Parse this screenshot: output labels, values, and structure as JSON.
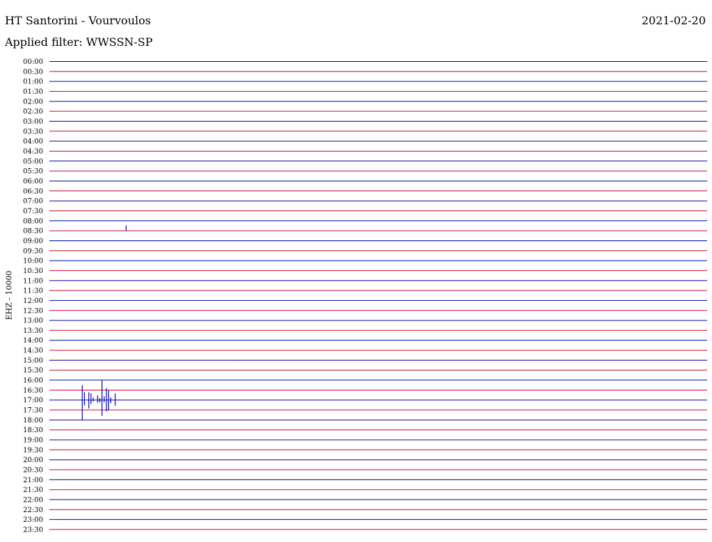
{
  "header": {
    "title": "HT Santorini - Vourvoulos",
    "date": "2021-02-20",
    "filter_label": "Applied filter: WWSSN-SP"
  },
  "chart_data": {
    "type": "line",
    "title": "HT Santorini - Vourvoulos",
    "ylabel": "EHZ - 10000",
    "row_labels": [
      "00:00",
      "00:30",
      "01:00",
      "01:30",
      "02:00",
      "02:30",
      "03:00",
      "03:30",
      "04:00",
      "04:30",
      "05:00",
      "05:30",
      "06:00",
      "06:30",
      "07:00",
      "07:30",
      "08:00",
      "08:30",
      "09:00",
      "09:30",
      "10:00",
      "10:30",
      "11:00",
      "11:30",
      "12:00",
      "12:30",
      "13:00",
      "13:30",
      "14:00",
      "14:30",
      "15:00",
      "15:30",
      "16:00",
      "16:30",
      "17:00",
      "17:30",
      "18:00",
      "18:30",
      "19:00",
      "19:30",
      "20:00",
      "20:30",
      "21:00",
      "21:30",
      "22:00",
      "22:30",
      "23:00",
      "23:30"
    ],
    "row_duration_minutes": 30,
    "row_colors": [
      "#0000aa",
      "#cc0033"
    ],
    "trace_color": "#0000aa",
    "grid": false,
    "events": [
      {
        "row": "08:30",
        "minute": 3.5,
        "min": -0.1,
        "max": 2.0
      },
      {
        "row": "15:00",
        "minute": 8.5,
        "min": -0.1,
        "max": 0.1
      },
      {
        "row": "17:00",
        "minute": 1.5,
        "min": -7.5,
        "max": 5.6
      },
      {
        "row": "17:00",
        "minute": 1.6,
        "min": -2.0,
        "max": 3.0
      },
      {
        "row": "17:00",
        "minute": 1.8,
        "min": -3.2,
        "max": 2.9
      },
      {
        "row": "17:00",
        "minute": 1.9,
        "min": -1.5,
        "max": 2.6
      },
      {
        "row": "17:00",
        "minute": 2.0,
        "min": -0.5,
        "max": 1.0
      },
      {
        "row": "17:00",
        "minute": 2.2,
        "min": -1.0,
        "max": 1.8
      },
      {
        "row": "17:00",
        "minute": 2.3,
        "min": -0.9,
        "max": 0.8
      },
      {
        "row": "17:00",
        "minute": 2.4,
        "min": -6.0,
        "max": 7.7
      },
      {
        "row": "17:00",
        "minute": 2.5,
        "min": -0.8,
        "max": 1.4
      },
      {
        "row": "17:00",
        "minute": 2.6,
        "min": -4.3,
        "max": 4.5
      },
      {
        "row": "17:00",
        "minute": 2.7,
        "min": -4.0,
        "max": 3.6
      },
      {
        "row": "17:00",
        "minute": 2.8,
        "min": -1.2,
        "max": 1.0
      },
      {
        "row": "17:00",
        "minute": 3.0,
        "min": -2.2,
        "max": 2.5
      },
      {
        "row": "17:00",
        "minute": 3.2,
        "min": -0.1,
        "max": 0.1
      }
    ]
  }
}
